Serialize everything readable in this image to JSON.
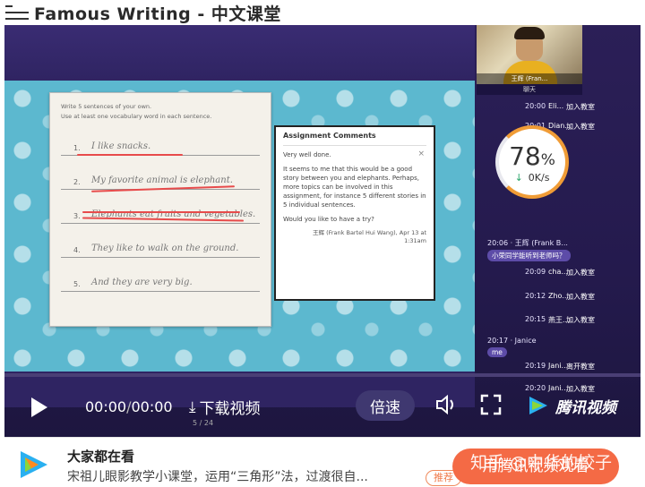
{
  "header": {
    "title": "Famous Writing - 中文课堂"
  },
  "worksheet": {
    "instructions": [
      "Write 5 sentences of your own.",
      "Use at least one vocabulary word in each sentence."
    ],
    "lines": [
      {
        "num": "1.",
        "text": "I like snacks."
      },
      {
        "num": "2.",
        "text": "My favorite animal is elephant."
      },
      {
        "num": "3.",
        "text": "Elephants eat fruits and vegetables."
      },
      {
        "num": "4.",
        "text": "They like to walk on the ground."
      },
      {
        "num": "5.",
        "text": "And they are very big."
      }
    ]
  },
  "comments": {
    "title": "Assignment Comments",
    "first": "Very well done.",
    "body": "It seems to me that this would be a good story between you and elephants. Perhaps, more topics can be involved in this assignment, for instance 5 different stories in 5 individual sentences.",
    "question": "Would you like to have a try?",
    "sign1": "王辉 (Frank Bartel Hui Wang), Apr 13 at",
    "sign2": "1:31am",
    "close": "×"
  },
  "webcam": {
    "name": "王辉 (Fran...",
    "chat_header": "聊天"
  },
  "chat": [
    {
      "time": "20:00",
      "user": "Eli...",
      "action": "加入教室"
    },
    {
      "time": "20:01",
      "user": "Dian...",
      "action": "加入教室"
    },
    {
      "time": "20:06 · 王辉 (Frank B...",
      "bubble": "小荣同学能听到老师吗？"
    },
    {
      "time": "20:09",
      "user": "cha...",
      "action": "加入教室"
    },
    {
      "time": "20:12",
      "user": "Zho...",
      "action": "加入教室"
    },
    {
      "time": "20:15",
      "user": "燕王...",
      "action": "加入教室"
    },
    {
      "time": "20:17 · Janice",
      "bubble": "me"
    },
    {
      "time": "20:19",
      "user": "Jani...",
      "action": "离开教室"
    },
    {
      "time": "20:20",
      "user": "Jani...",
      "action": "加入教室"
    }
  ],
  "speed": {
    "percent": "78",
    "unit": "%",
    "rate": "0K/s"
  },
  "controls": {
    "time_current": "00:00",
    "time_total": "00:00",
    "download": "下载视频",
    "speed": "倍速",
    "brand": "腾讯视频",
    "page": "5 / 24"
  },
  "recommend": {
    "title": "大家都在看",
    "desc": "宋祖儿眼影教学小课堂，运用“三角形”法，过渡很自...",
    "tag": "推荐",
    "button": "用腾讯视频观看",
    "watermark": "知乎 @中华的饺子"
  },
  "colors": {
    "accent": "#f46a45",
    "video_bg": "#2b1f57",
    "slide_bg": "#5cb8cf"
  }
}
